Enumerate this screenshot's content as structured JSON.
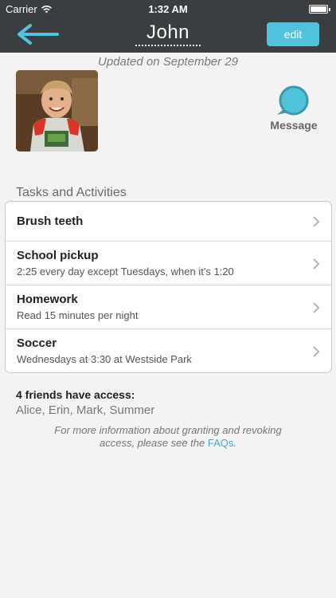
{
  "status_bar": {
    "carrier": "Carrier",
    "time": "1:32 AM"
  },
  "nav": {
    "title": "John",
    "edit_label": "edit"
  },
  "profile": {
    "updated_text": "Updated on September 29",
    "message_label": "Message"
  },
  "tasks": {
    "section_title": "Tasks and Activities",
    "items": [
      {
        "name": "Brush teeth",
        "detail": ""
      },
      {
        "name": "School pickup",
        "detail": "2:25 every day except Tuesdays, when it's 1:20"
      },
      {
        "name": "Homework",
        "detail": "Read 15 minutes per night"
      },
      {
        "name": "Soccer",
        "detail": "Wednesdays at 3:30 at Westside Park"
      }
    ]
  },
  "access": {
    "title": "4 friends have access:",
    "friends": "Alice, Erin, Mark, Summer",
    "info_prefix": "For more information about granting and revoking access, please see the ",
    "faq_link": "FAQs",
    "info_suffix": "."
  },
  "colors": {
    "accent": "#4fc3dc",
    "header": "#3b3e41",
    "link": "#3ea9cf"
  }
}
